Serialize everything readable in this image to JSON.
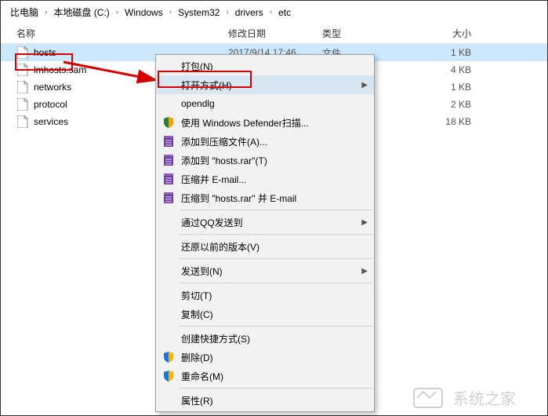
{
  "breadcrumb": [
    "比电脑",
    "本地磁盘 (C:)",
    "Windows",
    "System32",
    "drivers",
    "etc"
  ],
  "headers": {
    "name": "名称",
    "date": "修改日期",
    "type": "类型",
    "size": "大小"
  },
  "files": [
    {
      "name": "hosts",
      "date": "2017/9/14 17:46",
      "type": "文件",
      "size": "1 KB",
      "selected": true
    },
    {
      "name": "lmhosts.sam",
      "date": "",
      "type": "",
      "size": "4 KB"
    },
    {
      "name": "networks",
      "date": "",
      "type": "",
      "size": "1 KB"
    },
    {
      "name": "protocol",
      "date": "",
      "type": "",
      "size": "2 KB"
    },
    {
      "name": "services",
      "date": "",
      "type": "",
      "size": "18 KB"
    }
  ],
  "menu": [
    {
      "label": "打包(N)"
    },
    {
      "label": "打开方式(H)",
      "hover": true,
      "submenu": true,
      "highlight": true
    },
    {
      "label": "opendlg"
    },
    {
      "label": "使用 Windows Defender扫描...",
      "icon": "shield"
    },
    {
      "label": "添加到压缩文件(A)...",
      "icon": "rar"
    },
    {
      "label": "添加到 \"hosts.rar\"(T)",
      "icon": "rar"
    },
    {
      "label": "压缩并 E-mail...",
      "icon": "rar"
    },
    {
      "label": "压缩到 \"hosts.rar\" 并 E-mail",
      "icon": "rar"
    },
    {
      "sep": true
    },
    {
      "label": "通过QQ发送到",
      "submenu": true
    },
    {
      "sep": true
    },
    {
      "label": "还原以前的版本(V)"
    },
    {
      "sep": true
    },
    {
      "label": "发送到(N)",
      "submenu": true
    },
    {
      "sep": true
    },
    {
      "label": "剪切(T)"
    },
    {
      "label": "复制(C)"
    },
    {
      "sep": true
    },
    {
      "label": "创建快捷方式(S)"
    },
    {
      "label": "删除(D)",
      "icon": "shield-blue"
    },
    {
      "label": "重命名(M)",
      "icon": "shield-blue"
    },
    {
      "sep": true
    },
    {
      "label": "属性(R)"
    }
  ],
  "watermark": "系统之家"
}
